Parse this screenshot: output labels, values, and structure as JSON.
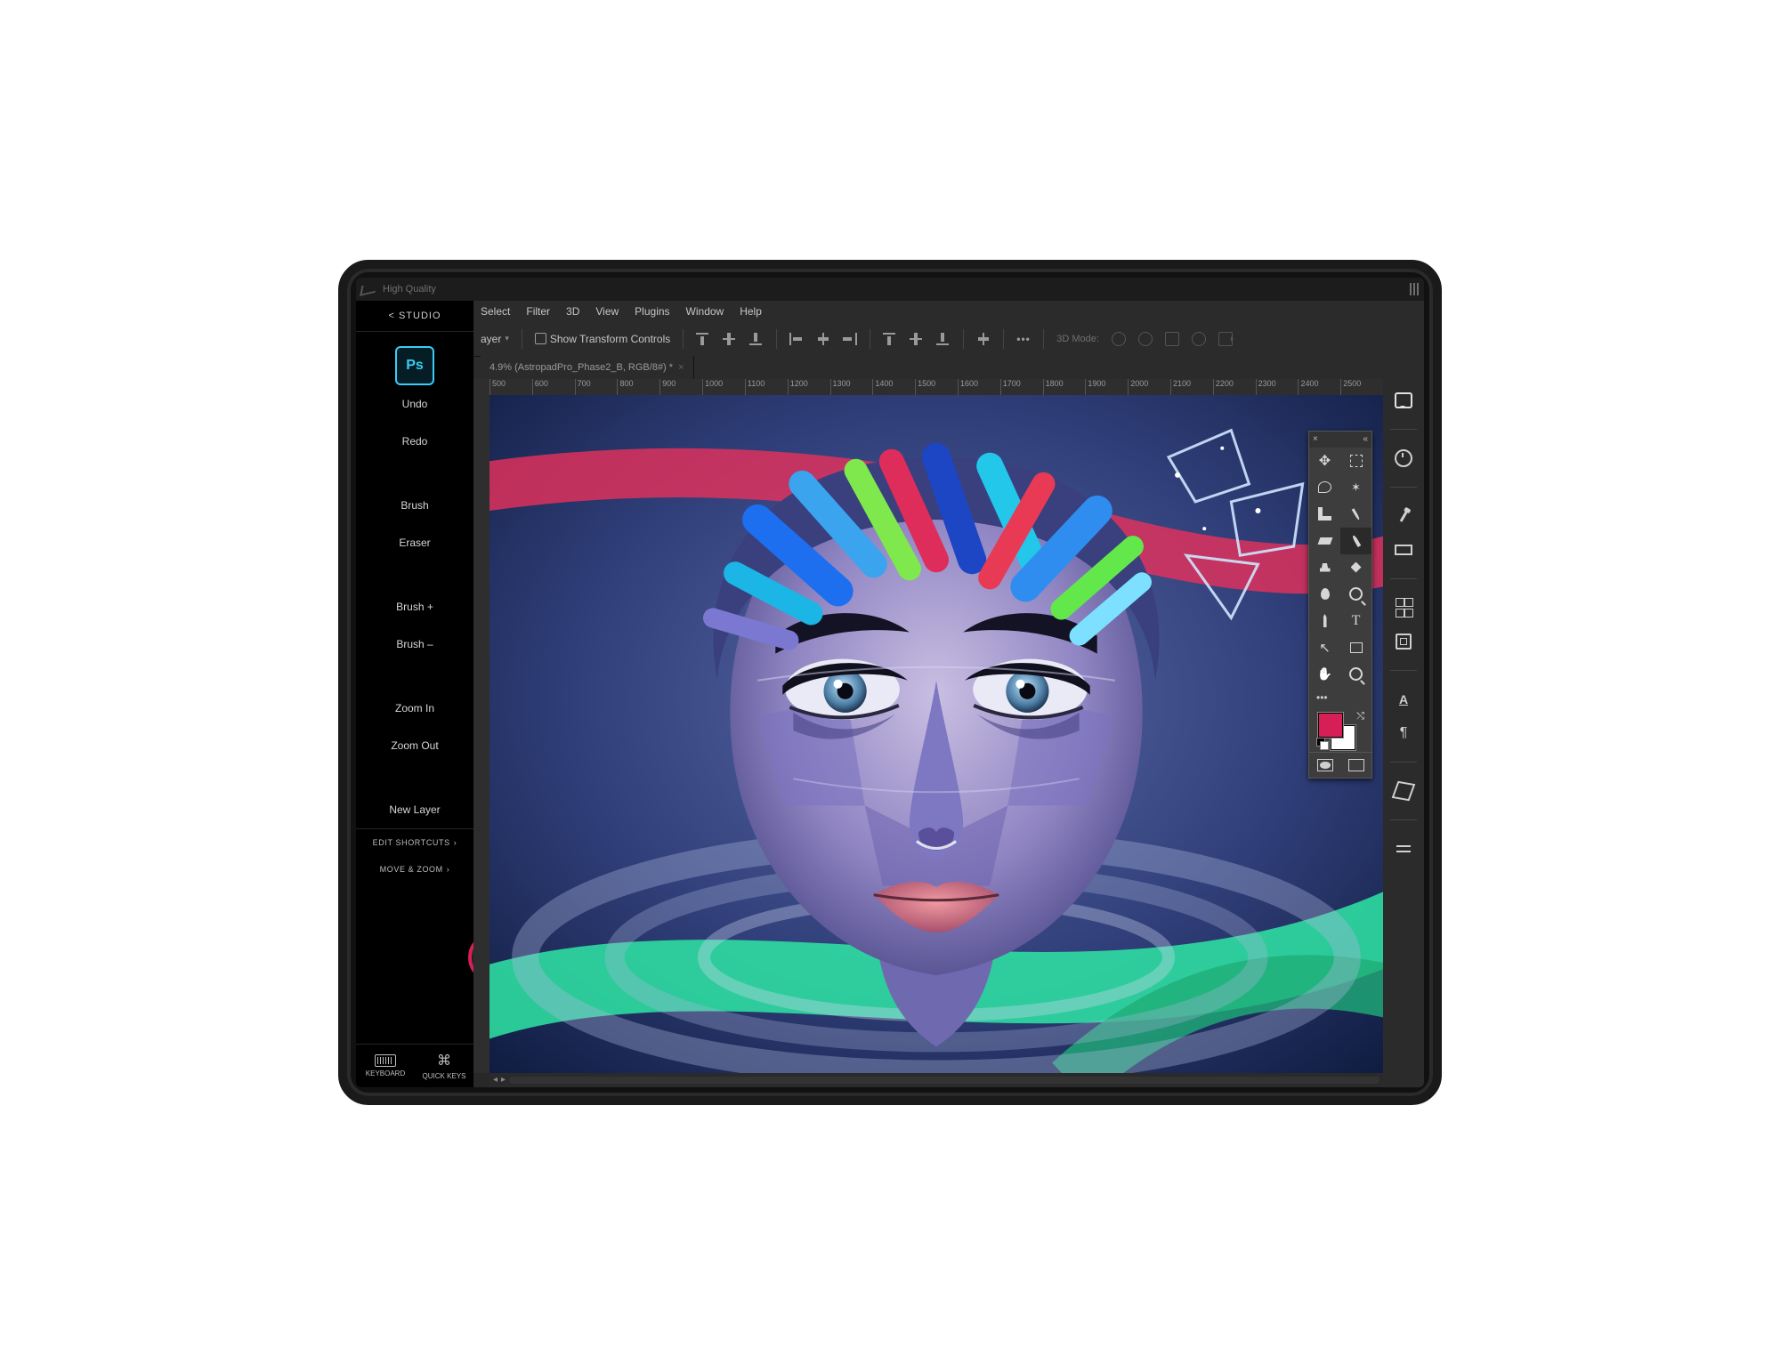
{
  "status": {
    "quality": "High Quality"
  },
  "astropad": {
    "back": "< STUDIO",
    "app_logo": "Ps",
    "shortcuts": [
      "Undo",
      "Redo",
      "Brush",
      "Eraser",
      "Brush +",
      "Brush –",
      "Zoom In",
      "Zoom Out",
      "New Layer"
    ],
    "edit_shortcuts": "EDIT SHORTCUTS",
    "move_zoom": "MOVE & ZOOM",
    "bottom": {
      "keyboard": "KEYBOARD",
      "quickkeys": "QUICK KEYS"
    }
  },
  "menubar": [
    "Select",
    "Filter",
    "3D",
    "View",
    "Plugins",
    "Window",
    "Help"
  ],
  "options": {
    "layer_pill": "ayer",
    "show_transform": "Show Transform Controls",
    "mode3d": "3D Mode:"
  },
  "doc": {
    "tab_title": "4.9% (AstropadPro_Phase2_B, RGB/8#) *"
  },
  "ruler_ticks": [
    "500",
    "600",
    "700",
    "800",
    "900",
    "1000",
    "1100",
    "1200",
    "1300",
    "1400",
    "1500",
    "1600",
    "1700",
    "1800",
    "1900",
    "2000",
    "2100",
    "2200",
    "2300",
    "2400",
    "2500"
  ],
  "tools_panel": {
    "ellipsis": "•••",
    "tools": [
      {
        "name": "move-tool",
        "sel": false
      },
      {
        "name": "marquee-tool",
        "sel": false
      },
      {
        "name": "lasso-tool",
        "sel": false
      },
      {
        "name": "magic-wand-tool",
        "sel": false
      },
      {
        "name": "crop-tool",
        "sel": false
      },
      {
        "name": "eyedropper-tool",
        "sel": false
      },
      {
        "name": "eraser-tool",
        "sel": false
      },
      {
        "name": "brush-tool",
        "sel": true
      },
      {
        "name": "clone-stamp-tool",
        "sel": false
      },
      {
        "name": "gradient-tool",
        "sel": false
      },
      {
        "name": "blur-tool",
        "sel": false
      },
      {
        "name": "dodge-tool",
        "sel": false
      },
      {
        "name": "pen-tool",
        "sel": false
      },
      {
        "name": "type-tool",
        "sel": false
      },
      {
        "name": "path-select-tool",
        "sel": false
      },
      {
        "name": "rectangle-tool",
        "sel": false
      },
      {
        "name": "hand-tool",
        "sel": false
      },
      {
        "name": "zoom-tool",
        "sel": false
      }
    ],
    "fg_color": "#d61f57",
    "bg_color": "#ffffff"
  },
  "right_strip_icons": [
    "comments",
    "history",
    "brushes",
    "brush-settings",
    "swatches",
    "clone-source",
    "layers",
    "character",
    "paragraph",
    "3d",
    "adjustments"
  ]
}
